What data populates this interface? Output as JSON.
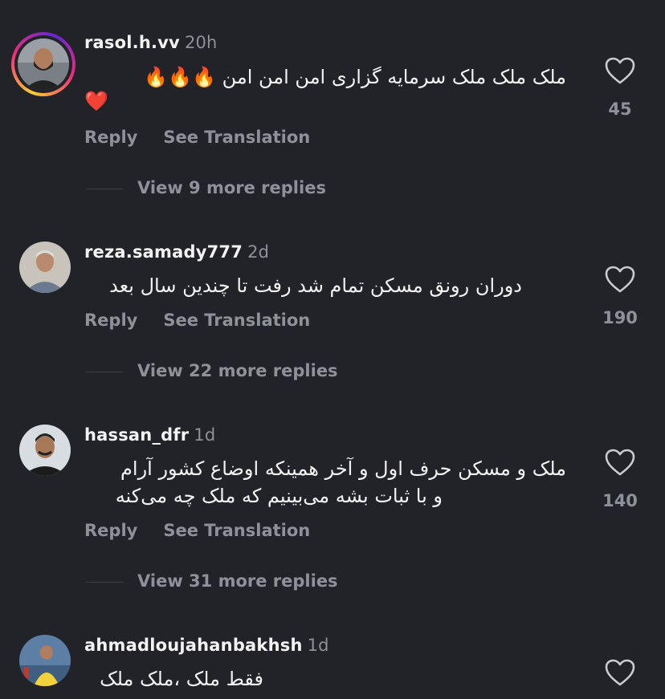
{
  "comments": [
    {
      "username": "rasol.h.vv",
      "time": "20h",
      "text_main": "ملک ملک ملک سرمایه گزاری امن امن امن 🔥🔥🔥",
      "text_extra": "❤️",
      "reply_label": "Reply",
      "translate_label": "See Translation",
      "likes": "45",
      "view_replies": "View 9 more replies",
      "story_ring": true
    },
    {
      "username": "reza.samady777",
      "time": "2d",
      "text_main": "دوران رونق مسکن تمام شد رفت تا چندین سال بعد",
      "reply_label": "Reply",
      "translate_label": "See Translation",
      "likes": "190",
      "view_replies": "View 22 more replies"
    },
    {
      "username": "hassan_dfr",
      "time": "1d",
      "text_line1": "ملک و مسکن حرف اول و آخر  همینکه اوضاع کشور آرام",
      "text_line2": "و با ثبات بشه می‌بینیم که ملک چه می‌کنه",
      "reply_label": "Reply",
      "translate_label": "See Translation",
      "likes": "140",
      "view_replies": "View 31 more replies"
    },
    {
      "username": "ahmadloujahanbakhsh",
      "time": "1d",
      "text_main": "فقط ملک ،ملک ملک"
    }
  ],
  "colors": {
    "background": "#212328",
    "primary_text": "#f2f2f2",
    "secondary_text": "#8e9198"
  },
  "icons": [
    "heart-icon",
    "fire-emoji",
    "red-heart-emoji"
  ]
}
